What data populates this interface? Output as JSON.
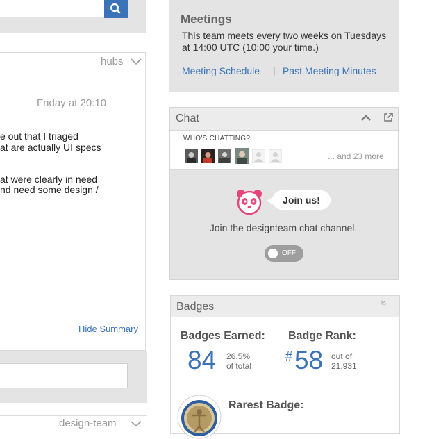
{
  "left": {
    "post_tag": "hubs",
    "post_date": "Friday at 20:10",
    "post_lines": [
      "e out that I triaged",
      "at are actually UI specs",
      "",
      "at were clearly in need",
      "nd need some design /"
    ],
    "hide_summary": "Hide Summary",
    "next_tag": "design-team"
  },
  "meetings": {
    "title": "Meetings",
    "description": "This team meets every two weeks on Tuesdays at 14:00 UTC (10:00 your time.)",
    "schedule_link": "Meeting Schedule",
    "separator": "|",
    "minutes_link": "Past Meeting Minutes"
  },
  "chat": {
    "title": "Chat",
    "whos_chatting": "WHO'S CHATTING?",
    "more": "... and 23 more",
    "join_bubble": "Join us!",
    "join_text": "Join the designteam chat channel.",
    "toggle_label": "OFF"
  },
  "badges": {
    "title": "Badges",
    "earned_label": "Badges Earned:",
    "earned_count": "84",
    "earned_pct": "26.5%",
    "earned_pct_suffix": "of total",
    "rank_label": "Badge Rank:",
    "rank_hash": "#",
    "rank_value": "58",
    "rank_out_of": "out of",
    "rank_total": "21,931",
    "rarest_label": "Rarest Badge:"
  },
  "colors": {
    "accent": "#3b73b9",
    "panel": "#e4e4e4",
    "panda_pink": "#e6457a"
  },
  "icons": [
    "search-icon",
    "chevron-down-icon",
    "chevron-up-icon",
    "external-link-icon",
    "panda-icon",
    "badge-medal-icon"
  ]
}
